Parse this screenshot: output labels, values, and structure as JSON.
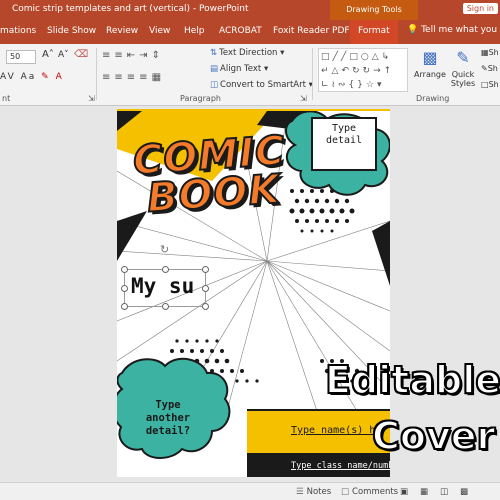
{
  "window": {
    "title": "Comic strip templates and art (vertical)  -  PowerPoint",
    "context_tab_group": "Drawing Tools",
    "signin_label": "Sign in"
  },
  "tabs": [
    {
      "label": "mations"
    },
    {
      "label": "Slide Show"
    },
    {
      "label": "Review"
    },
    {
      "label": "View"
    },
    {
      "label": "Help"
    },
    {
      "label": "ACROBAT"
    },
    {
      "label": "Foxit Reader PDF"
    },
    {
      "label": "Format"
    }
  ],
  "tellme": {
    "icon": "lightbulb-icon",
    "text": "Tell me what you wa"
  },
  "ribbon": {
    "font_size_value": "50",
    "text_direction_label": "Text Direction",
    "align_text_label": "Align Text",
    "convert_smartart_label": "Convert to SmartArt",
    "paragraph_group_label": "Paragraph",
    "drawing_group_label": "Drawing",
    "arrange_label": "Arrange",
    "quick_styles_label_1": "Quick",
    "quick_styles_label_2": "Styles",
    "left_group_label_fragment": "nt",
    "shape_fill_fragment": "Sh",
    "shape_outline_fragment": "Sh",
    "shape_effects_fragment": "Sh"
  },
  "slide": {
    "title_line1": "COMIC",
    "title_line2": "BOOK",
    "detail_text": "Type detail",
    "subtitle_partial": "My su",
    "cloud_text": "Type another detail?",
    "names_text": "Type name(s) he",
    "class_text": "Type class name/number",
    "colors": {
      "yellow": "#f5c000",
      "teal": "#3cb3a2",
      "orange": "#f47b2a",
      "black": "#1a1a1a"
    }
  },
  "overlay": {
    "line1": "Editable",
    "line2": "Cover"
  },
  "statusbar": {
    "notes_label": "Notes",
    "comments_label": "Comments"
  },
  "colors": {
    "ribbon_accent": "#b7472a",
    "context_tab": "#c55a11"
  }
}
